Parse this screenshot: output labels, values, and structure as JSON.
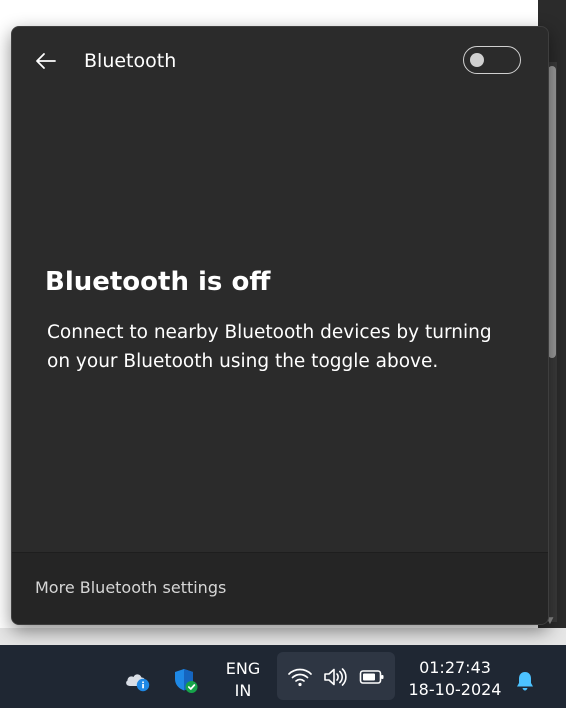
{
  "flyout": {
    "title": "Bluetooth",
    "toggle_state": "off",
    "heading": "Bluetooth is off",
    "description": "Connect to nearby Bluetooth devices by turning on your Bluetooth using the toggle above.",
    "footer_link": "More Bluetooth settings"
  },
  "taskbar": {
    "language_line1": "ENG",
    "language_line2": "IN",
    "time": "01:27:43",
    "date": "18-10-2024",
    "icons": [
      "onedrive-info-icon",
      "windows-security-icon",
      "wifi-icon",
      "volume-icon",
      "battery-icon",
      "notification-bell-icon"
    ]
  },
  "colors": {
    "flyout_bg": "#2b2b2b",
    "footer_bg": "#252525",
    "taskbar_bg": "#1f2733",
    "bell_accent": "#4cc2ff",
    "security_blue": "#1e88e5",
    "security_check": "#16a34a",
    "onedrive_badge": "#1e88e5"
  }
}
